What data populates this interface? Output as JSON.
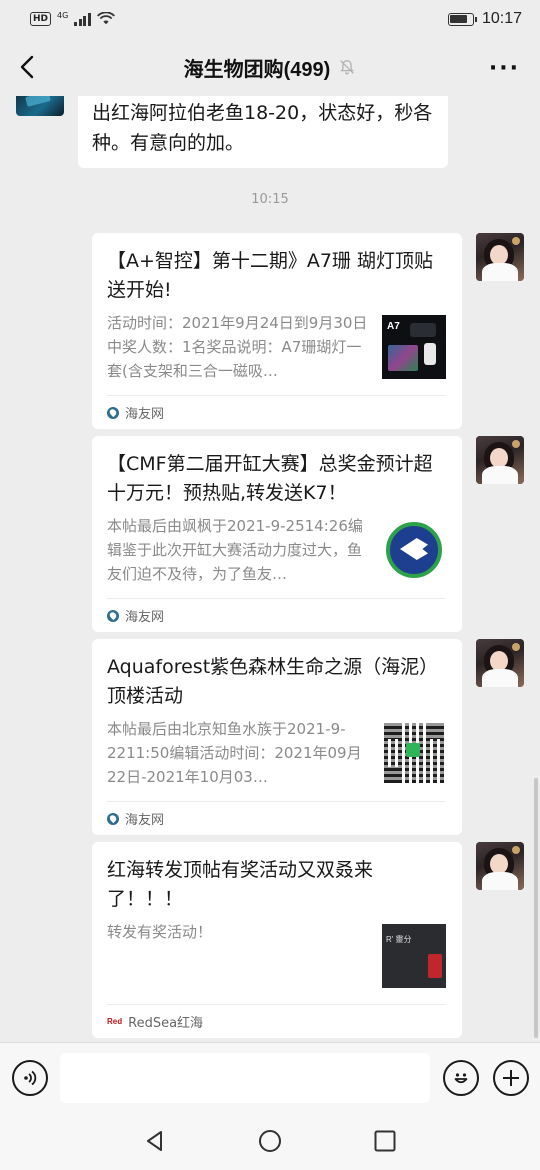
{
  "status": {
    "network": "HD",
    "signal_type": "4G",
    "battery_level": 0.8,
    "time": "10:17"
  },
  "header": {
    "title": "海生物团购(499)"
  },
  "partial_message": {
    "text": "出红海阿拉伯老鱼18-20，状态好，秒各种。有意向的加。"
  },
  "time_separator": "10:15",
  "messages": [
    {
      "title": "【A+智控】第十二期》A7珊 瑚灯顶贴送开始!",
      "desc": "活动时间：2021年9月24日到9月30日中奖人数：1名奖品说明：A7珊瑚灯一套(含支架和三合一磁吸…",
      "source": "海友网",
      "thumb_text": "A7"
    },
    {
      "title": "【CMF第二届开缸大赛】总奖金预计超十万元！预热贴,转发送K7！",
      "desc": "本帖最后由飒枫于2021-9-2514:26编辑鉴于此次开缸大赛活动力度过大，鱼友们迫不及待，为了鱼友…",
      "source": "海友网"
    },
    {
      "title": "Aquaforest紫色森林生命之源（海泥）顶楼活动",
      "desc": "本帖最后由北京知鱼水族于2021-9-2211:50编辑活动时间：2021年09月22日-2021年10月03…",
      "source": "海友网"
    },
    {
      "title": "红海转发顶帖有奖活动又双叒来了！！！",
      "desc": "转发有奖活动！",
      "source": "RedSea红海",
      "source_logo": "Red",
      "thumb_text": "R' 靈分"
    }
  ],
  "input": {
    "value": ""
  }
}
